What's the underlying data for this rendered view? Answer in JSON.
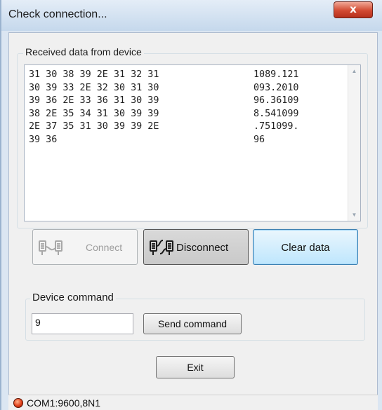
{
  "window": {
    "title": "Check connection...",
    "close_label": "x"
  },
  "received_group": {
    "label": "Received data from device",
    "hex_lines": [
      "31 30 38 39 2E 31 32 31",
      "30 39 33 2E 32 30 31 30",
      "39 36 2E 33 36 31 30 39",
      "38 2E 35 34 31 30 39 39",
      "2E 37 35 31 30 39 39 2E",
      "39 36"
    ],
    "ascii_lines": [
      "1089.121",
      "093.2010",
      "96.36109",
      "8.541099",
      ".751099.",
      "96"
    ]
  },
  "buttons": {
    "connect_label": "Connect",
    "disconnect_label": "Disconnect",
    "clear_label": "Clear data",
    "send_label": "Send command",
    "exit_label": "Exit"
  },
  "command_group": {
    "label": "Device command",
    "input_value": "9"
  },
  "status": {
    "port_text": "COM1:9600,8N1",
    "led_color": "#e2401a"
  },
  "icons": {
    "connect": "plug-connect-icon",
    "disconnect": "plug-disconnect-icon",
    "led": "status-led-icon"
  }
}
